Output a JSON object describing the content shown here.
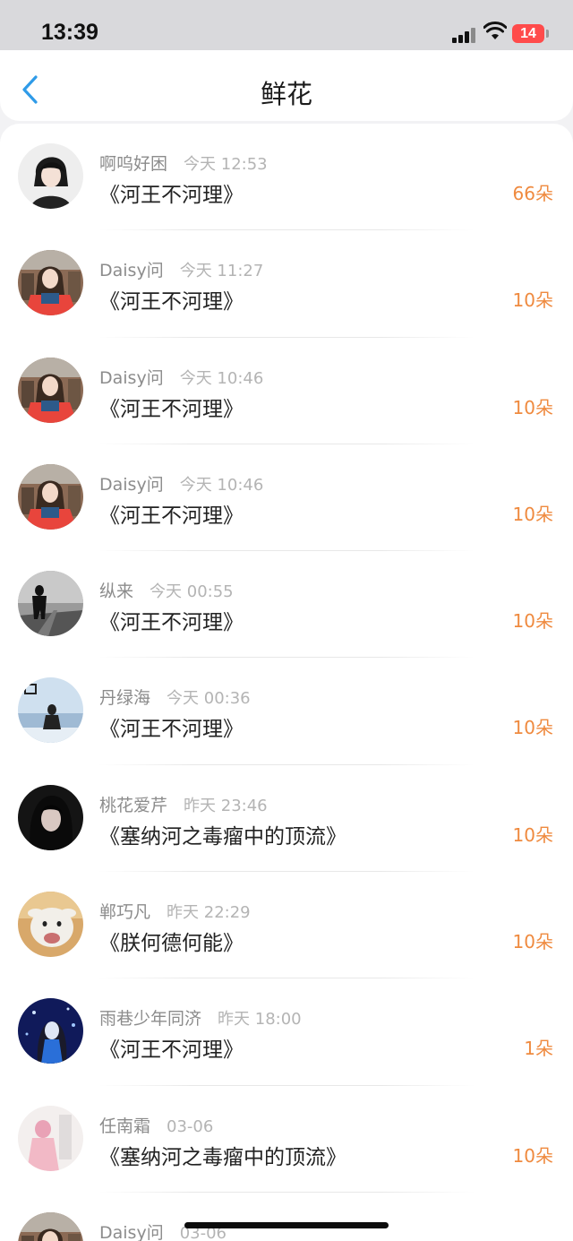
{
  "status_bar": {
    "time": "13:39",
    "battery": "14"
  },
  "header": {
    "title": "鲜花",
    "back_icon": "chevron-left-icon"
  },
  "colors": {
    "accent": "#2f9be8",
    "count": "#ef8a3f"
  },
  "items": [
    {
      "name": "啊呜好困",
      "time": "今天 12:53",
      "book": "《河王不河理》",
      "count": "66朵",
      "avatar": "anime-boy"
    },
    {
      "name": "Daisy问",
      "time": "今天 11:27",
      "book": "《河王不河理》",
      "count": "10朵",
      "avatar": "girl-red"
    },
    {
      "name": "Daisy问",
      "time": "今天 10:46",
      "book": "《河王不河理》",
      "count": "10朵",
      "avatar": "girl-red"
    },
    {
      "name": "Daisy问",
      "time": "今天 10:46",
      "book": "《河王不河理》",
      "count": "10朵",
      "avatar": "girl-red"
    },
    {
      "name": "纵来",
      "time": "今天 00:55",
      "book": "《河王不河理》",
      "count": "10朵",
      "avatar": "grey-figure"
    },
    {
      "name": "丹绿海",
      "time": "今天 00:36",
      "book": "《河王不河理》",
      "count": "10朵",
      "avatar": "lake-girl"
    },
    {
      "name": "桃花爱芹",
      "time": "昨天 23:46",
      "book": "《塞纳河之毒瘤中的顶流》",
      "count": "10朵",
      "avatar": "dark-girl"
    },
    {
      "name": "郸巧凡",
      "time": "昨天 22:29",
      "book": "《朕何德何能》",
      "count": "10朵",
      "avatar": "goat"
    },
    {
      "name": "雨巷少年同济",
      "time": "昨天 18:00",
      "book": "《河王不河理》",
      "count": "1朵",
      "avatar": "blue-night"
    },
    {
      "name": "任南霜",
      "time": "03-06",
      "book": "《塞纳河之毒瘤中的顶流》",
      "count": "10朵",
      "avatar": "pink-figure"
    },
    {
      "name": "Daisy问",
      "time": "03-06",
      "book": "",
      "count": "",
      "avatar": "girl-red"
    }
  ]
}
